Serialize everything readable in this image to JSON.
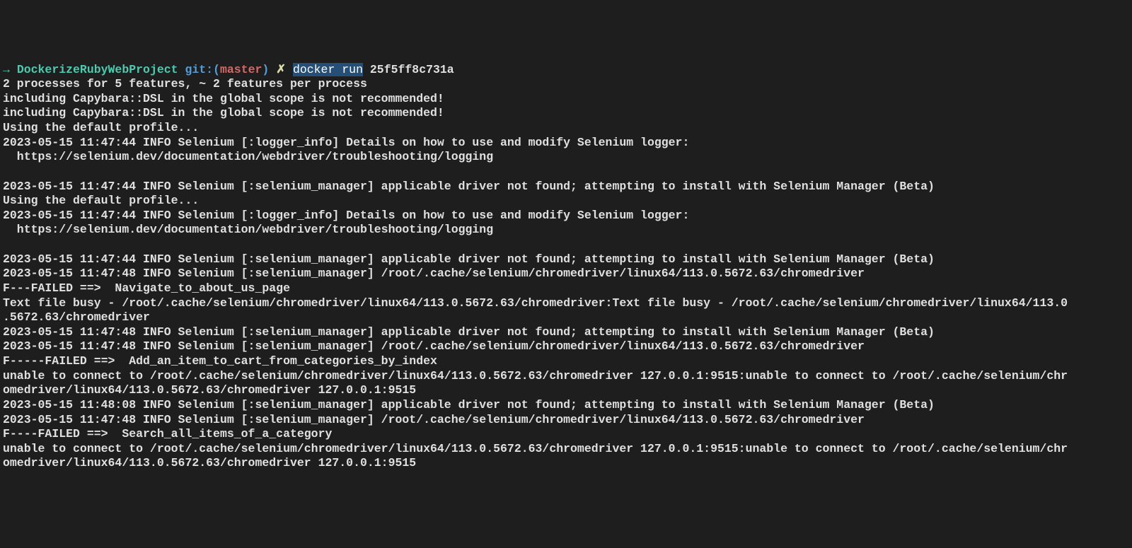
{
  "prompt": {
    "arrow": "→ ",
    "project": "DockerizeRubyWebProject",
    "git_label": " git:(",
    "branch": "master",
    "git_close": ") ",
    "x": "✗ ",
    "selected_cmd": "docker run",
    "cmd_rest": " 25f5ff8c731a"
  },
  "lines": [
    "2 processes for 5 features, ~ 2 features per process",
    "including Capybara::DSL in the global scope is not recommended!",
    "including Capybara::DSL in the global scope is not recommended!",
    "Using the default profile...",
    "2023-05-15 11:47:44 INFO Selenium [:logger_info] Details on how to use and modify Selenium logger:",
    "  https://selenium.dev/documentation/webdriver/troubleshooting/logging",
    "",
    "2023-05-15 11:47:44 INFO Selenium [:selenium_manager] applicable driver not found; attempting to install with Selenium Manager (Beta)",
    "Using the default profile...",
    "2023-05-15 11:47:44 INFO Selenium [:logger_info] Details on how to use and modify Selenium logger:",
    "  https://selenium.dev/documentation/webdriver/troubleshooting/logging",
    "",
    "2023-05-15 11:47:44 INFO Selenium [:selenium_manager] applicable driver not found; attempting to install with Selenium Manager (Beta)",
    "2023-05-15 11:47:48 INFO Selenium [:selenium_manager] /root/.cache/selenium/chromedriver/linux64/113.0.5672.63/chromedriver",
    "F---FAILED ==>  Navigate_to_about_us_page",
    "Text file busy - /root/.cache/selenium/chromedriver/linux64/113.0.5672.63/chromedriver:Text file busy - /root/.cache/selenium/chromedriver/linux64/113.0",
    ".5672.63/chromedriver",
    "2023-05-15 11:47:48 INFO Selenium [:selenium_manager] applicable driver not found; attempting to install with Selenium Manager (Beta)",
    "2023-05-15 11:47:48 INFO Selenium [:selenium_manager] /root/.cache/selenium/chromedriver/linux64/113.0.5672.63/chromedriver",
    "F-----FAILED ==>  Add_an_item_to_cart_from_categories_by_index",
    "unable to connect to /root/.cache/selenium/chromedriver/linux64/113.0.5672.63/chromedriver 127.0.0.1:9515:unable to connect to /root/.cache/selenium/chr",
    "omedriver/linux64/113.0.5672.63/chromedriver 127.0.0.1:9515",
    "2023-05-15 11:48:08 INFO Selenium [:selenium_manager] applicable driver not found; attempting to install with Selenium Manager (Beta)",
    "2023-05-15 11:47:48 INFO Selenium [:selenium_manager] /root/.cache/selenium/chromedriver/linux64/113.0.5672.63/chromedriver",
    "F----FAILED ==>  Search_all_items_of_a_category",
    "unable to connect to /root/.cache/selenium/chromedriver/linux64/113.0.5672.63/chromedriver 127.0.0.1:9515:unable to connect to /root/.cache/selenium/chr",
    "omedriver/linux64/113.0.5672.63/chromedriver 127.0.0.1:9515"
  ]
}
